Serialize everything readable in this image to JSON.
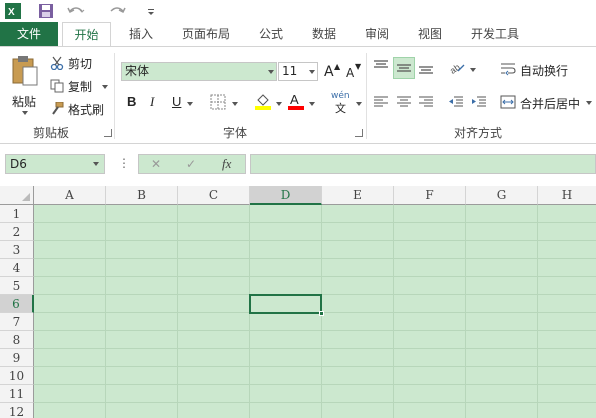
{
  "tabs": [
    "文件",
    "开始",
    "插入",
    "页面布局",
    "公式",
    "数据",
    "审阅",
    "视图",
    "开发工具"
  ],
  "clipboard": {
    "paste": "粘贴",
    "cut": "剪切",
    "copy": "复制",
    "format_painter": "格式刷",
    "group_label": "剪贴板"
  },
  "font": {
    "name": "宋体",
    "size": "11",
    "group_label": "字体",
    "bold": "B",
    "italic": "I",
    "underline": "U",
    "grow": "A",
    "shrink": "A",
    "font_color_letter": "A",
    "phonetic": "wén"
  },
  "alignment": {
    "wrap_text": "自动换行",
    "merge_center": "合并后居中",
    "group_label": "对齐方式"
  },
  "formula_bar": {
    "name_box": "D6",
    "fx": "fx",
    "cancel": "✕",
    "enter": "✓",
    "more": "⋮"
  },
  "columns": [
    "A",
    "B",
    "C",
    "D",
    "E",
    "F",
    "G",
    "H"
  ],
  "rows": [
    "1",
    "2",
    "3",
    "4",
    "5",
    "6",
    "7",
    "8",
    "9",
    "10",
    "11",
    "12"
  ],
  "active_cell": "D6",
  "colors": {
    "accent": "#217346",
    "sheet_bg": "#cce8cf",
    "highlight": "#ffff00",
    "font_color": "#ff0000"
  }
}
